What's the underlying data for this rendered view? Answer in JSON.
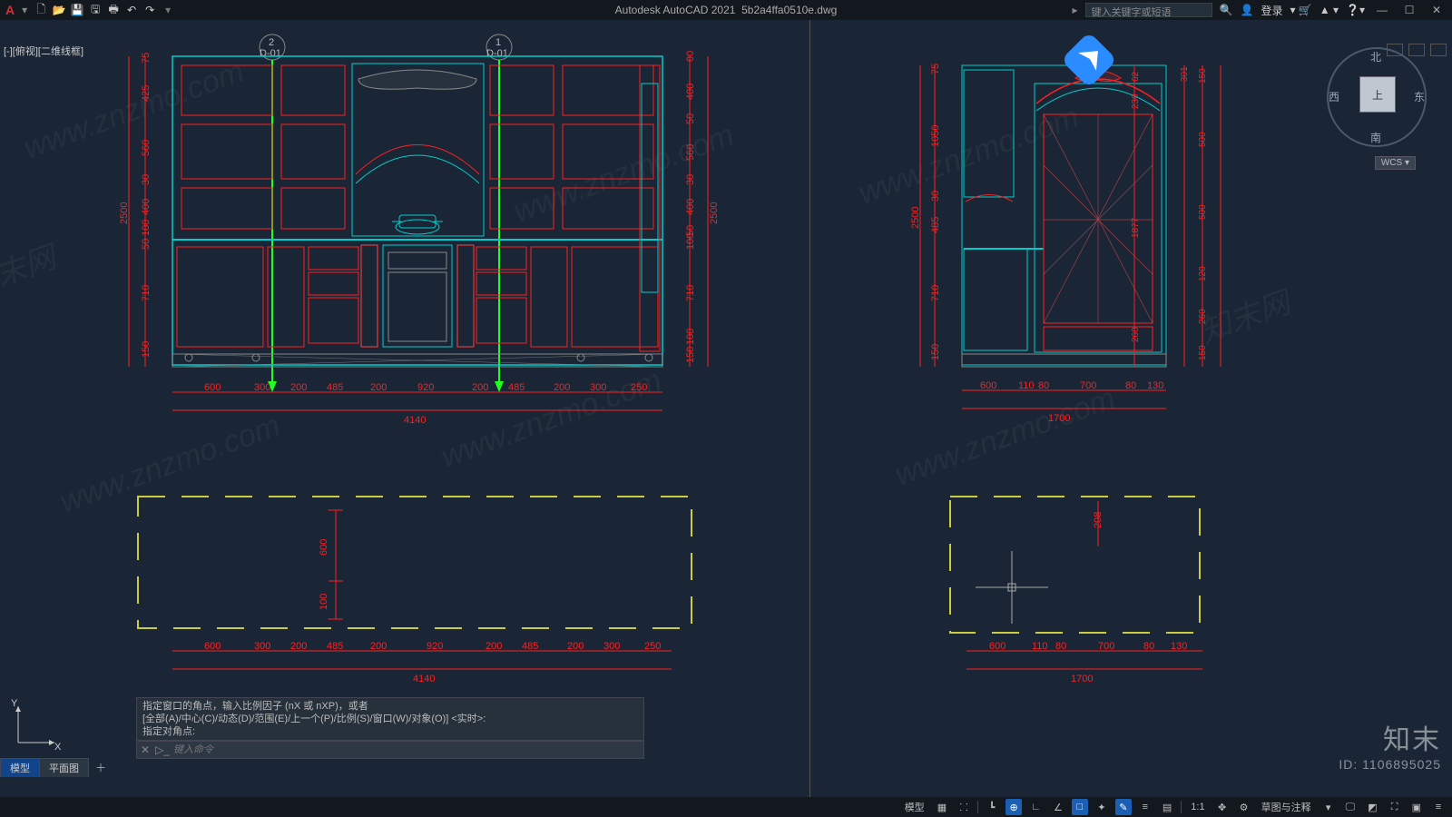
{
  "app": {
    "title": "Autodesk AutoCAD 2021",
    "file": "5b2a4ffa0510e.dwg"
  },
  "qat": [
    "new-icon",
    "open-icon",
    "save-icon",
    "saveas-icon",
    "plot-icon",
    "undo-icon",
    "redo-icon"
  ],
  "search": {
    "placeholder": "键入关键字或短语"
  },
  "login_label": "登录",
  "win_btns": [
    "—",
    "☐",
    "✕"
  ],
  "viewport_label": "[-][俯视][二维线框]",
  "viewcube": {
    "top": "上",
    "n": "北",
    "s": "南",
    "e": "东",
    "w": "西",
    "wcs": "WCS"
  },
  "section_marks": {
    "left": {
      "num": "2",
      "code": "D-01"
    },
    "right": {
      "num": "1",
      "code": "D-01"
    }
  },
  "elevA": {
    "h_dims": [
      "600",
      "300",
      "200",
      "485",
      "200",
      "920",
      "200",
      "485",
      "200",
      "300",
      "250"
    ],
    "h_total": "4140",
    "v_left": [
      "75",
      "425",
      "560",
      "30",
      "400",
      "100",
      "50",
      "710",
      "150"
    ],
    "v_left_total": "2500",
    "v_right": [
      "00",
      "400",
      "50",
      "560",
      "30",
      "400",
      "50",
      "100",
      "710",
      "100",
      "150"
    ],
    "v_right_total": "2500"
  },
  "elevB": {
    "h_dims": [
      "600",
      "110",
      "80",
      "700",
      "80",
      "130"
    ],
    "h_total": "1700",
    "v_left": [
      "75",
      "1050",
      "30",
      "485",
      "710",
      "150"
    ],
    "v_left_total": "2500",
    "v_right_outer": [
      "150",
      "500",
      "500",
      "120",
      "260",
      "150"
    ],
    "v_right_inner": [
      "62",
      "230",
      "1877",
      "260"
    ],
    "v_right_inner2": [
      "301"
    ]
  },
  "planA": {
    "h_dims": [
      "600",
      "300",
      "200",
      "485",
      "200",
      "920",
      "200",
      "485",
      "200",
      "300",
      "250"
    ],
    "h_total": "4140",
    "v": [
      "600",
      "100"
    ]
  },
  "planB": {
    "h_dims": [
      "600",
      "110",
      "80",
      "700",
      "80",
      "130"
    ],
    "h_total": "1700",
    "v": [
      "208"
    ]
  },
  "cmd": {
    "line1": "指定窗口的角点，输入比例因子 (nX 或 nXP)，或者",
    "line2": "[全部(A)/中心(C)/动态(D)/范围(E)/上一个(P)/比例(S)/窗口(W)/对象(O)] <实时>:",
    "line3": "指定对角点:",
    "placeholder": "键入命令"
  },
  "tabs": {
    "model": "模型",
    "layout": "平面图"
  },
  "status": {
    "left": "模型",
    "scale": "1:1",
    "annot": "草图与注释",
    "items": [
      "模型",
      "grid-icon",
      "snap-icon",
      "infer-icon",
      "ortho-icon",
      "polar-icon",
      "osnap-icon",
      "3dosnap-icon",
      "otrack-icon",
      "dyn-icon",
      "lwt-icon",
      "transp-icon",
      "cycle-icon"
    ]
  },
  "watermark": {
    "brand": "知末",
    "id": "ID: 1106895025",
    "diag": "www.znzmo.com"
  }
}
